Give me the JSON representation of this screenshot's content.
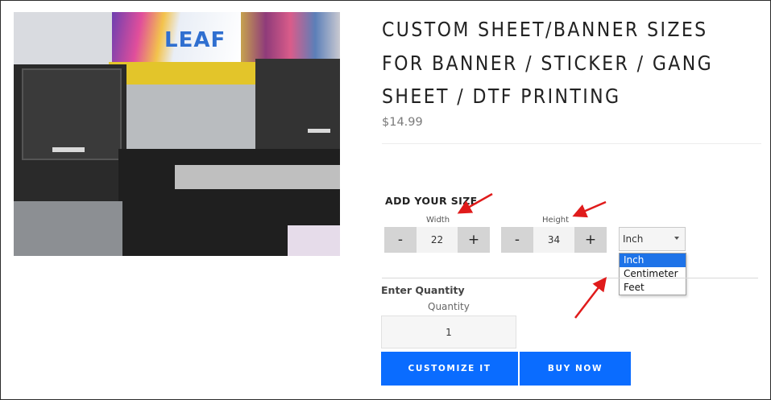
{
  "product": {
    "title": "CUSTOM SHEET/BANNER SIZES FOR BANNER / STICKER / GANG SHEET / DTF PRINTING",
    "price": "$14.99",
    "image": {
      "alt": "Printer machine photo",
      "poster_text": "LEAF"
    }
  },
  "size": {
    "heading": "ADD YOUR SIZE",
    "width": {
      "label": "Width",
      "value": "22",
      "minus": "-",
      "plus": "+"
    },
    "height": {
      "label": "Height",
      "value": "34",
      "minus": "-",
      "plus": "+"
    },
    "unit": {
      "selected": "Inch",
      "options": [
        "Inch",
        "Centimeter",
        "Feet"
      ],
      "highlighted_index": 0
    }
  },
  "quantity": {
    "heading": "Enter Quantity",
    "label": "Quantity",
    "value": "1"
  },
  "actions": {
    "customize": "CUSTOMIZE IT",
    "buy": "BUY NOW"
  },
  "colors": {
    "accent": "#0a6cff",
    "annotation_arrow": "#e01b1b",
    "option_highlight": "#1e73e8"
  }
}
